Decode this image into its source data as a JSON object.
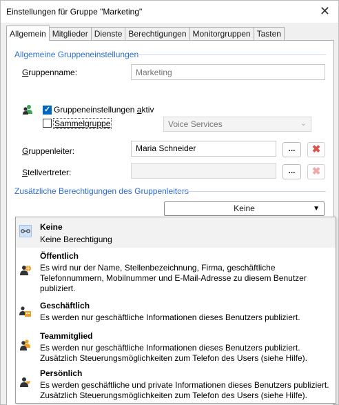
{
  "window": {
    "title": "Einstellungen für Gruppe \"Marketing\"",
    "close": "✕"
  },
  "tabs": [
    "Allgemein",
    "Mitglieder",
    "Dienste",
    "Berechtigungen",
    "Monitorgruppen",
    "Tasten"
  ],
  "general": {
    "section_title": "Allgemeine Gruppeneinstellungen",
    "group_name_label_pre": "G",
    "group_name_label_rest": "ruppenname:",
    "group_name_placeholder": "Marketing",
    "active_label_pre": "Gruppeneinstellungen ",
    "active_label_u": "a",
    "active_label_post": "ktiv",
    "active_checked": true,
    "collective_label": "Sammelgruppe",
    "collective_checked": false,
    "service_select": "Voice Services",
    "leader_label_pre": "G",
    "leader_label_rest": "ruppenleiter:",
    "leader_value": "Maria Schneider",
    "deputy_label_pre": "S",
    "deputy_label_rest": "tellvertreter:",
    "deputy_value": "",
    "browse_label": "...",
    "delete_symbol": "✖"
  },
  "permissions": {
    "section_title": "Zusätzliche Berechtigungen des Gruppenleiters",
    "selected": "Keine",
    "options": [
      {
        "title": "Keine",
        "desc": [
          "Keine Berechtigung"
        ],
        "icon": "link-icon"
      },
      {
        "title": "Öffentlich",
        "desc": [
          "Es wird nur der Name, Stellenbezeichnung, Firma, geschäftliche",
          "Telefonnummern, Mobilnummer und E-Mail-Adresse zu diesem Benutzer",
          "publiziert."
        ],
        "icon": "user-globe-icon"
      },
      {
        "title": "Geschäftlich",
        "desc": [
          "Es werden nur geschäftliche Informationen dieses Benutzers publiziert."
        ],
        "icon": "user-building-icon"
      },
      {
        "title": "Teammitglied",
        "desc": [
          "Es werden nur geschäftliche Informationen dieses Benutzers publiziert.",
          "Zusätzlich Steuerungsmöglichkeiten zum Telefon des Users (siehe Hilfe)."
        ],
        "icon": "user-team-icon"
      },
      {
        "title": "Persönlich",
        "desc": [
          "Es werden geschäftliche und private Informationen dieses Benutzers publiziert.",
          "Zusätzlich Steuerungsmöglichkeiten zum Telefon des Users (siehe Hilfe)."
        ],
        "icon": "user-heart-icon"
      }
    ]
  }
}
